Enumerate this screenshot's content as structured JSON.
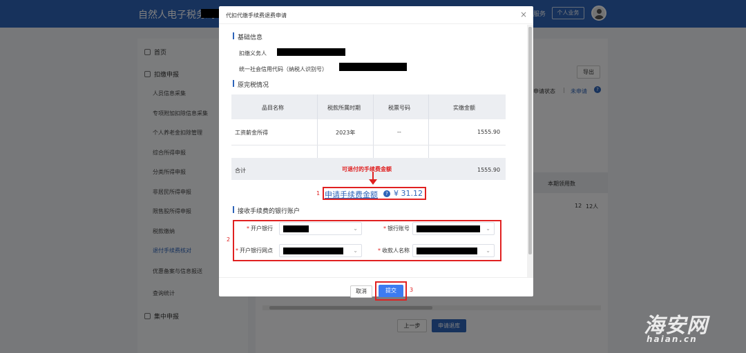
{
  "app": {
    "title": "自然人电子税务局",
    "service_link": "服务",
    "personal_business": "个人业务"
  },
  "sidebar": {
    "home": "首页",
    "declare_group": "扣缴申报",
    "items": [
      "人员信息采集",
      "专项附加扣除信息采集",
      "个人养老金扣除管理",
      "综合所得申报",
      "分类所得申报",
      "非居民所得申报",
      "限售股所得申报",
      "税款缴纳",
      "退付手续费核对",
      "优惠备案与信息报送",
      "查询统计"
    ],
    "centralized": "集中申报"
  },
  "background": {
    "export": "导出",
    "status_label": "申请状态",
    "status_sep": "|",
    "status_value": "未申请",
    "column_head": "本期领用数",
    "cell_a": "12",
    "cell_b": "12人",
    "prev_step": "上一步",
    "apply_refund": "申请退库"
  },
  "modal": {
    "title": "代扣代缴手续费退费申请",
    "close": "×",
    "basic_info": "基础信息",
    "withholding_agent_label": "扣缴义务人",
    "credit_code_label": "统一社会信用代码（纳税人识别号）",
    "tax_section": "原完税情况",
    "table": {
      "headers": [
        "品目名称",
        "税款所属时期",
        "税票号码",
        "实缴金额"
      ],
      "rows": [
        [
          "工资薪金所得",
          "2023年",
          "--",
          "1555.90"
        ]
      ],
      "total_label": "合计",
      "total_amount": "1555.90"
    },
    "refund_note": "可退付的手续费金额",
    "fee_label": "申请手续费金额",
    "fee_value": "¥ 31.12",
    "bank_section": "接收手续费的银行账户",
    "fields": {
      "bank": "开户银行",
      "account_no": "银行账号",
      "branch": "开户银行网点",
      "payee": "收款人名称"
    },
    "cancel": "取消",
    "submit": "提交",
    "markers": [
      "1",
      "2",
      "3"
    ]
  },
  "watermark": {
    "big": "海安网",
    "small": "haian.cn"
  },
  "colors": {
    "brand": "#2e64b9",
    "annotation": "#e02020",
    "primary_button": "#3d7bf0"
  }
}
